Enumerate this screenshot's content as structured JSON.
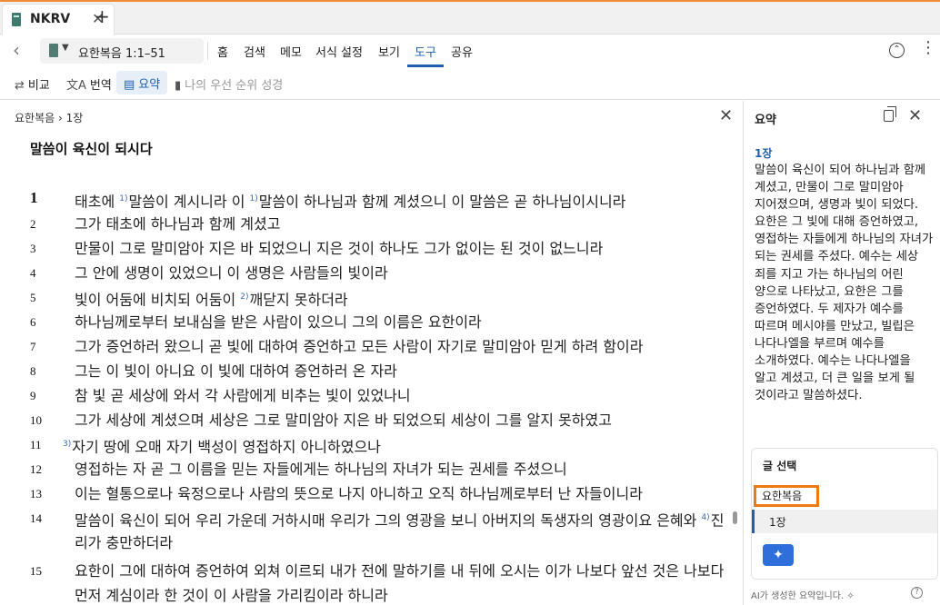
{
  "tab": {
    "title": "NKRV",
    "close": "✕",
    "new_tab": "+"
  },
  "nav": {
    "reference": "요한복음 1:1–51",
    "menus": [
      "홈",
      "검색",
      "메모",
      "서식 설정",
      "보기",
      "도구",
      "공유"
    ],
    "active_menu": "도구"
  },
  "toolbar": {
    "compare": "비교",
    "translate": "번역",
    "summary": "요약",
    "priority_bibles": "나의 우선 순위 성경"
  },
  "main": {
    "breadcrumb": "요한복음 › 1장",
    "heading": "말씀이 육신이 되시다",
    "verses": [
      {
        "n": "1",
        "parts": [
          {
            "t": "태초에 "
          },
          {
            "fn": "1)"
          },
          {
            "t": "말씀이 계시니라 이 "
          },
          {
            "fn": "1)"
          },
          {
            "t": "말씀이 하나님과 함께 계셨으니 이 말씀은 곧 하나님이시니라"
          }
        ]
      },
      {
        "n": "2",
        "parts": [
          {
            "t": "그가 태초에 하나님과 함께 계셨고"
          }
        ]
      },
      {
        "n": "3",
        "parts": [
          {
            "t": "만물이 그로 말미암아 지은 바 되었으니 지은 것이 하나도 그가 없이는 된 것이 없느니라"
          }
        ]
      },
      {
        "n": "4",
        "parts": [
          {
            "t": "그 안에 생명이 있었으니 이 생명은 사람들의 빛이라"
          }
        ]
      },
      {
        "n": "5",
        "parts": [
          {
            "t": "빛이 어둠에 비치되 어둠이 "
          },
          {
            "fn": "2)"
          },
          {
            "t": "깨닫지 못하더라"
          }
        ]
      },
      {
        "n": "6",
        "parts": [
          {
            "t": "하나님께로부터 보내심을 받은 사람이 있으니 그의 이름은 요한이라"
          }
        ]
      },
      {
        "n": "7",
        "parts": [
          {
            "t": "그가 증언하러 왔으니 곧 빛에 대하여 증언하고 모든 사람이 자기로 말미암아 믿게 하려 함이라"
          }
        ]
      },
      {
        "n": "8",
        "parts": [
          {
            "t": "그는 이 빛이 아니요 이 빛에 대하여 증언하러 온 자라"
          }
        ]
      },
      {
        "n": "9",
        "parts": [
          {
            "t": "참 빛 곧 세상에 와서 각 사람에게 비추는 빛이 있었나니"
          }
        ]
      },
      {
        "n": "10",
        "parts": [
          {
            "t": "그가 세상에 계셨으며 세상은 그로 말미암아 지은 바 되었으되 세상이 그를 알지 못하였고"
          }
        ]
      },
      {
        "n": "11",
        "parts": [
          {
            "fn": "3)"
          },
          {
            "t": "자기 땅에 오매 자기 백성이 영접하지 아니하였으나"
          }
        ]
      },
      {
        "n": "12",
        "parts": [
          {
            "t": "영접하는 자 곧 그 이름을 믿는 자들에게는 하나님의 자녀가 되는 권세를 주셨으니"
          }
        ]
      },
      {
        "n": "13",
        "parts": [
          {
            "t": "이는 혈통으로나 육정으로나 사람의 뜻으로 나지 아니하고 오직 하나님께로부터 난 자들이니라"
          }
        ]
      },
      {
        "n": "14",
        "parts": [
          {
            "t": "말씀이 육신이 되어 우리 가운데 거하시매 우리가 그의 영광을 보니 아버지의 독생자의 영광이요 은혜와 "
          },
          {
            "fn": "4)"
          },
          {
            "t": "진"
          }
        ],
        "cont": "리가 충만하더라"
      },
      {
        "n": "15",
        "parts": [
          {
            "t": "요한이 그에 대하여 증언하여 외쳐 이르되 내가 전에 말하기를 내 뒤에 오시는 이가 나보다 앞선 것은 나보다"
          }
        ],
        "cont": "먼저 계심이라 한 것이 이 사람을 가리킴이라 하니라"
      }
    ]
  },
  "side": {
    "title": "요약",
    "chapter": "1장",
    "summary": "말씀이 육신이 되어 하나님과 함께 계셨고, 만물이 그로 말미암아 지어졌으며, 생명과 빛이 되었다. 요한은 그 빛에 대해 증언하였고, 영접하는 자들에게 하나님의 자녀가 되는 권세를 주셨다. 예수는 세상 죄를 지고 가는 하나님의 어린 양으로 나타났고, 요한은 그를 증언하였다. 두 제자가 예수를 따르며 메시야를 만났고, 빌립은 나다나엘을 부르며 예수를 소개하였다. 예수는 나다나엘을 알고 계셨고, 더 큰 일을 보게 될 것이라고 말씀하셨다.",
    "select_title": "글 선택",
    "selected_book": "요한복음",
    "selected_chapter": "1장",
    "ai_note": "AI가 생성한 요약입니다.",
    "help": "?"
  },
  "colors": {
    "accent": "#1f5fad",
    "highlight": "#f07a12",
    "tab_accent": "#f08b3a"
  }
}
